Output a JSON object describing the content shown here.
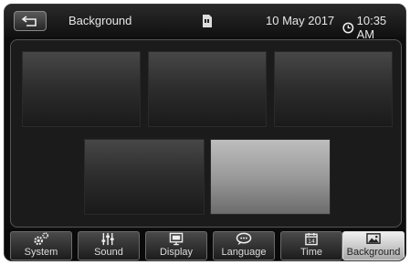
{
  "header": {
    "title": "Background",
    "date": "10 May 2017",
    "time": "10:35 AM",
    "back_icon": "back-arrow-icon",
    "storage_icon": "sd-card-icon",
    "clock_icon": "clock-icon"
  },
  "wallpapers": {
    "items": [
      {
        "selected": false
      },
      {
        "selected": false
      },
      {
        "selected": false
      },
      {
        "selected": false
      },
      {
        "selected": true
      }
    ],
    "selected_index": 4
  },
  "tabs": [
    {
      "label": "System",
      "icon": "gears-icon"
    },
    {
      "label": "Sound",
      "icon": "equalizer-icon"
    },
    {
      "label": "Display",
      "icon": "monitor-icon"
    },
    {
      "label": "Language",
      "icon": "speech-bubble-icon"
    },
    {
      "label": "Time",
      "icon": "calendar-icon"
    },
    {
      "label": "Background",
      "icon": "picture-icon",
      "active": true
    }
  ],
  "colors": {
    "active_tab": "#d0d0d0",
    "background": "#0e0e0e"
  }
}
